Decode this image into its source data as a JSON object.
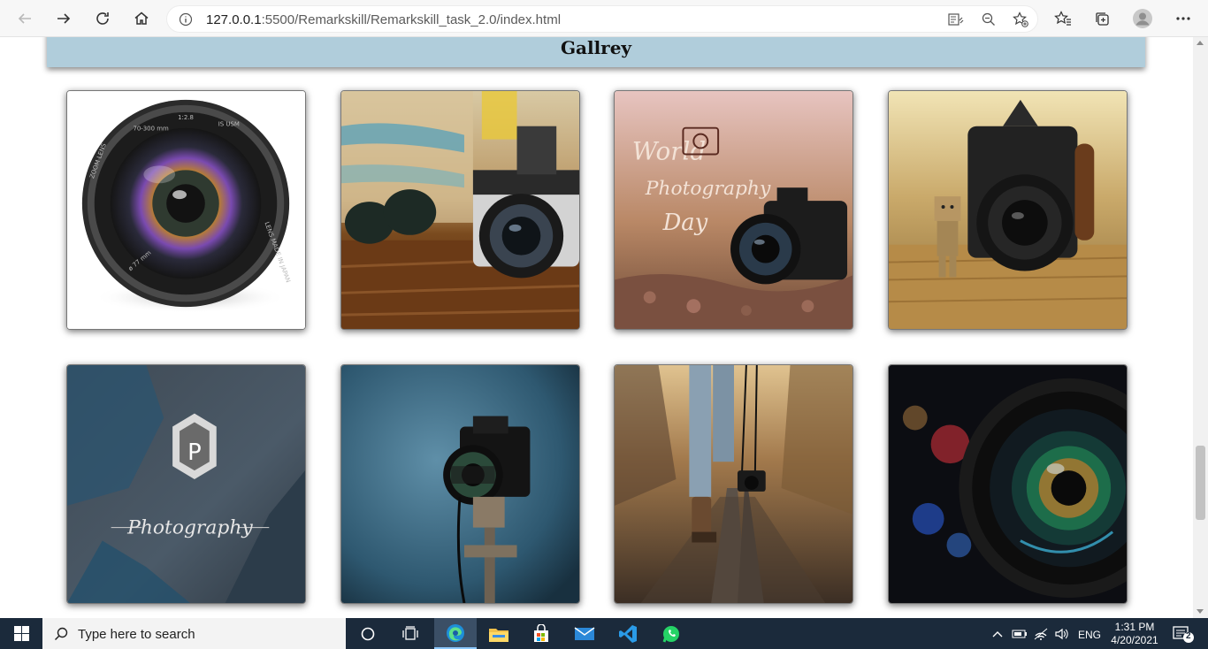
{
  "browser": {
    "url_host": "127.0.0.1",
    "url_rest": ":5500/Remarkskill/Remarkskill_task_2.0/index.html"
  },
  "page": {
    "title": "Gallrey",
    "gallery": [
      {
        "name": "camera-lens-white",
        "lens_text_1": "ZOOM LENS",
        "lens_text_2": "70-300 mm",
        "lens_text_3": "1:2.8",
        "lens_text_4": "IS USM",
        "lens_text_5": "LENS MADE IN JAPAN",
        "lens_text_6": "ø 77 mm"
      },
      {
        "name": "vintage-camera-sunglasses"
      },
      {
        "name": "world-photography-day",
        "caption_1": "World",
        "caption_2": "Photography",
        "caption_3": "Day"
      },
      {
        "name": "pentax-camera-danbo"
      },
      {
        "name": "photography-logo",
        "logo_letter": "P",
        "caption": "Photography"
      },
      {
        "name": "nikon-on-tripod"
      },
      {
        "name": "walking-on-rails"
      },
      {
        "name": "lens-closeup-bokeh"
      }
    ]
  },
  "taskbar": {
    "search_placeholder": "Type here to search",
    "lang": "ENG",
    "time": "1:31 PM",
    "date": "4/20/2021",
    "notifications": "2"
  }
}
